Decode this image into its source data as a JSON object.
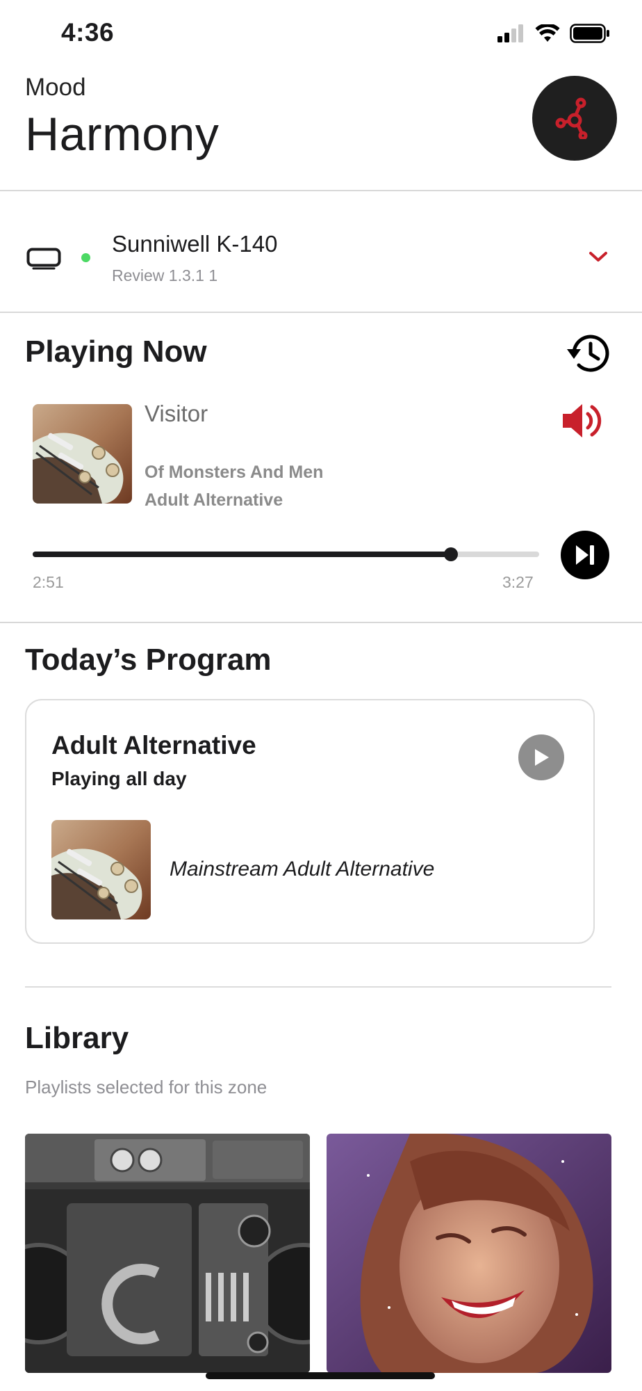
{
  "status_bar": {
    "time": "4:36",
    "icons": [
      "signal-icon",
      "wifi-icon",
      "battery-icon"
    ]
  },
  "header": {
    "subtitle": "Mood",
    "title": "Harmony",
    "action_icon": "network-node-icon"
  },
  "device": {
    "name": "Sunniwell K-140",
    "version": "Review 1.3.1 1",
    "status": "online",
    "status_color": "#4cd964"
  },
  "playing_now": {
    "section_title": "Playing Now",
    "track_title": "Visitor",
    "artist": "Of Monsters And Men",
    "genre": "Adult Alternative",
    "elapsed": "2:51",
    "duration": "3:27",
    "progress_fraction": 0.826
  },
  "todays_program": {
    "section_title": "Today’s Program",
    "program_name": "Adult Alternative",
    "schedule": "Playing all day",
    "playlist": "Mainstream Adult Alternative"
  },
  "library": {
    "section_title": "Library",
    "subtitle": "Playlists selected for this zone",
    "tiles": [
      "boombox-playlist",
      "party-playlist"
    ]
  },
  "colors": {
    "accent": "#c8202b",
    "text_primary": "#1c1c1e",
    "text_secondary": "#8e8e93"
  }
}
